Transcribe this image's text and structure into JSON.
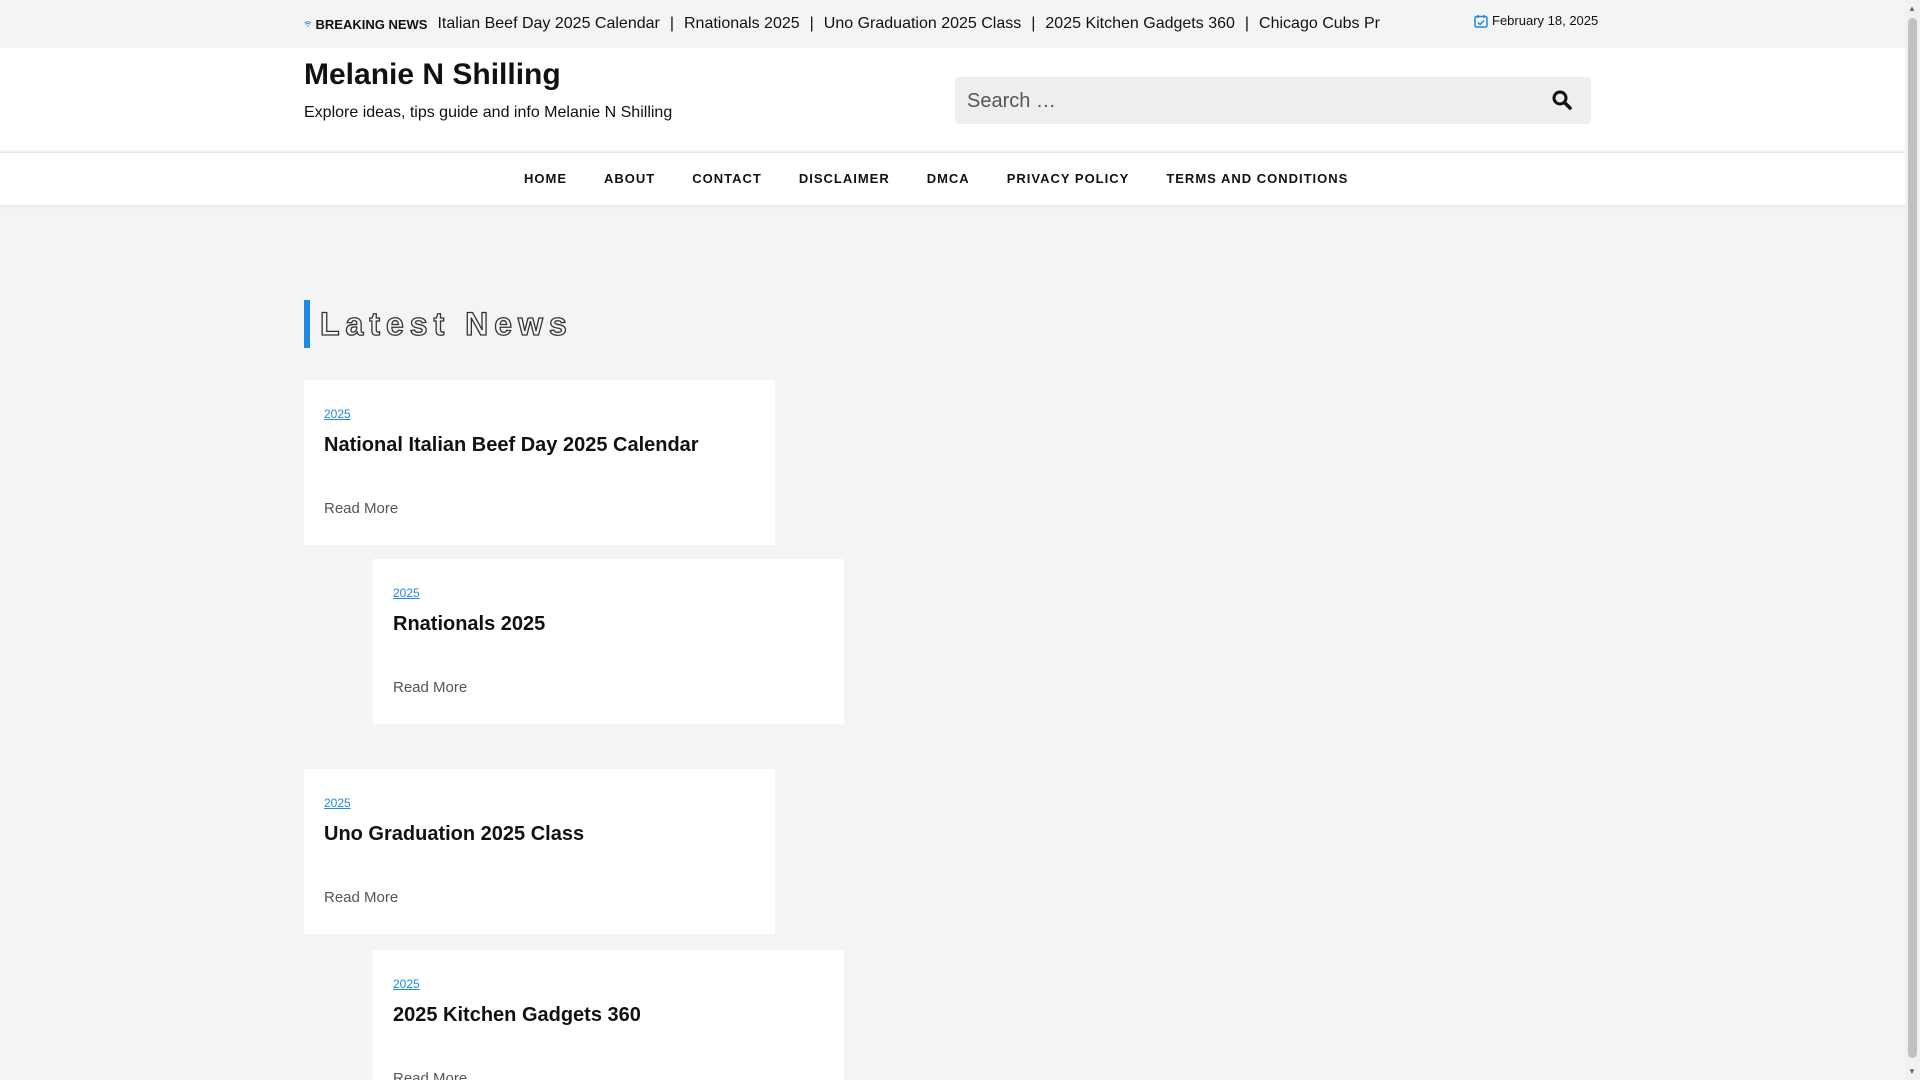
{
  "topbar": {
    "breaking_label": "BREAKING NEWS",
    "ticker": [
      "Italian Beef Day 2025 Calendar",
      "Rnationals 2025",
      "Uno Graduation 2025 Class",
      "2025 Kitchen Gadgets 360",
      "Chicago Cubs Pr"
    ],
    "separator": "|",
    "date": "February 18, 2025"
  },
  "header": {
    "site_title": "Melanie N Shilling",
    "tagline": "Explore ideas, tips guide and info Melanie N Shilling"
  },
  "search": {
    "placeholder": "Search …"
  },
  "nav": {
    "items": [
      "HOME",
      "ABOUT",
      "CONTACT",
      "DISCLAIMER",
      "DMCA",
      "PRIVACY POLICY",
      "TERMS AND CONDITIONS"
    ]
  },
  "section": {
    "title": "Latest News"
  },
  "posts": [
    {
      "category": "2025",
      "title": "National Italian Beef Day 2025 Calendar",
      "read_more": "Read More"
    },
    {
      "category": "2025",
      "title": "Rnationals 2025",
      "read_more": "Read More"
    },
    {
      "category": "2025",
      "title": "Uno Graduation 2025 Class",
      "read_more": "Read More"
    },
    {
      "category": "2025",
      "title": "2025 Kitchen Gadgets 360",
      "read_more": "Read More"
    }
  ],
  "colors": {
    "accent": "#1e88e5",
    "page_bg": "#f4f4f4",
    "card_bg": "#ffffff"
  }
}
